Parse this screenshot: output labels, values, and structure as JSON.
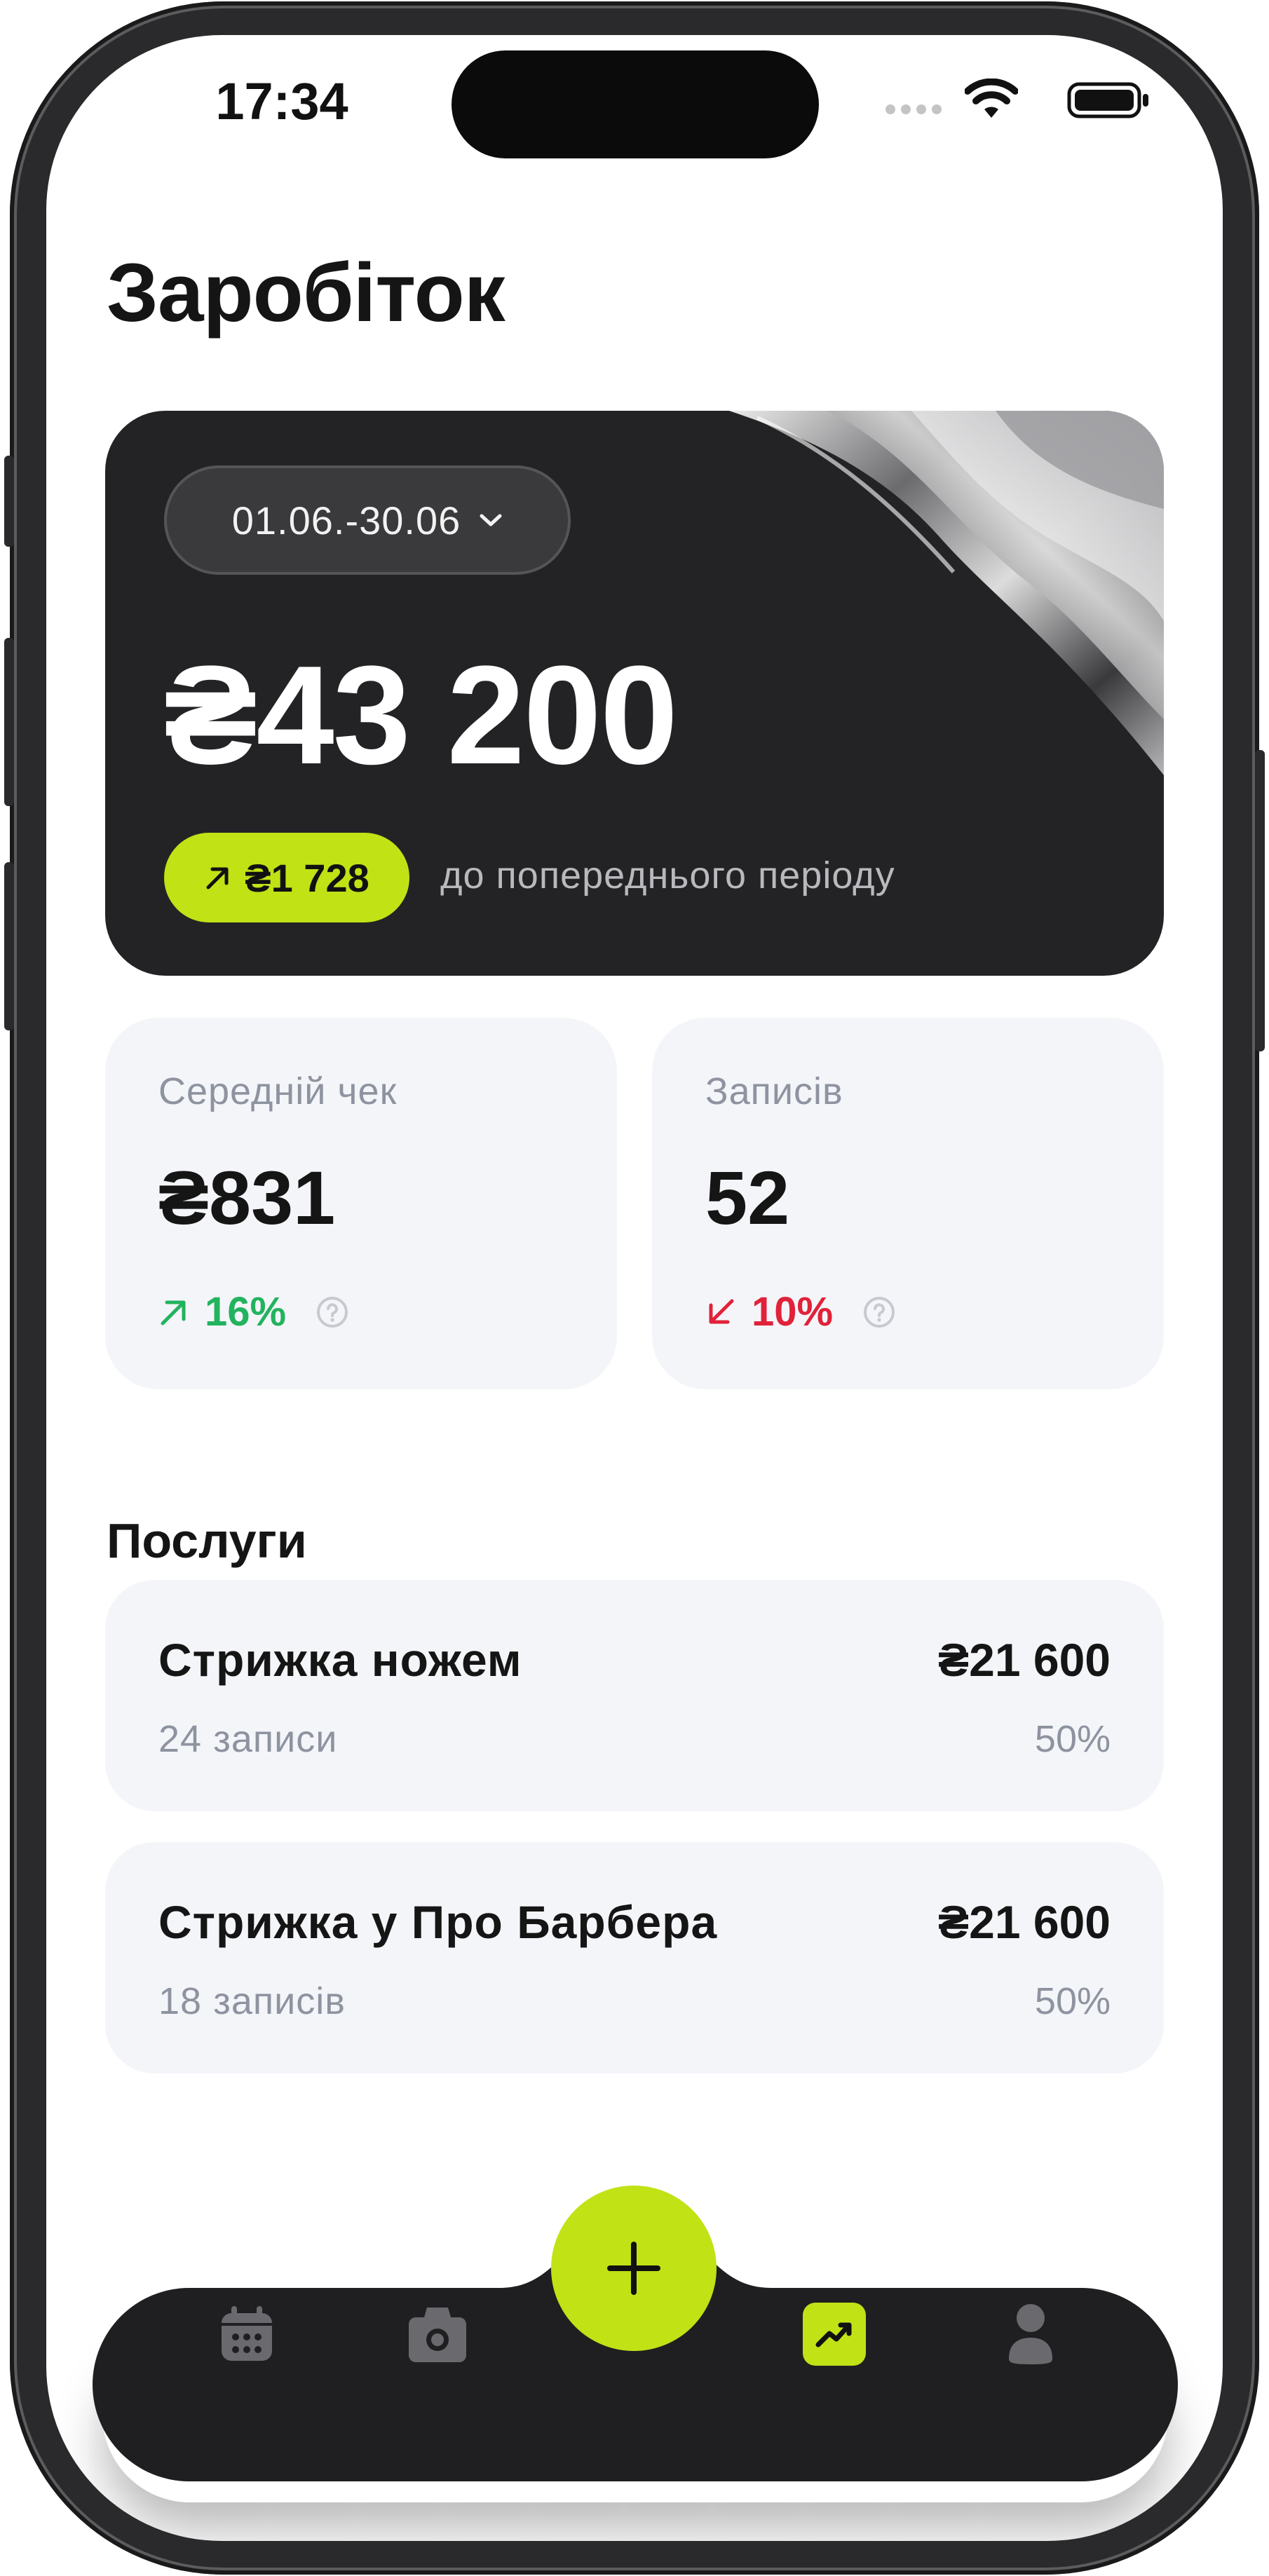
{
  "status_bar": {
    "time": "17:34"
  },
  "page": {
    "title": "Заробіток"
  },
  "earnings_card": {
    "period": "01.06.-30.06",
    "total": "₴43 200",
    "delta": "₴1 728",
    "delta_caption": "до попереднього періоду"
  },
  "stats": [
    {
      "label": "Середній чек",
      "value": "₴831",
      "delta": "16%",
      "trend": "up",
      "color": "#22b35e"
    },
    {
      "label": "Записів",
      "value": "52",
      "delta": "10%",
      "trend": "down",
      "color": "#e0223a"
    }
  ],
  "services": {
    "title": "Послуги",
    "items": [
      {
        "name": "Стрижка ножем",
        "count": "24 записи",
        "amount": "₴21 600",
        "share": "50%"
      },
      {
        "name": "Стрижка у Про Барбера",
        "count": "18 записів",
        "amount": "₴21 600",
        "share": "50%"
      }
    ]
  },
  "nav": {
    "items": [
      "calendar-icon",
      "camera-icon",
      "plus-icon",
      "trending-up-icon",
      "user-icon"
    ],
    "active": "trending-up-icon"
  },
  "colors": {
    "accent": "#c1e215",
    "dark": "#232326",
    "card": "#f4f5f9"
  }
}
